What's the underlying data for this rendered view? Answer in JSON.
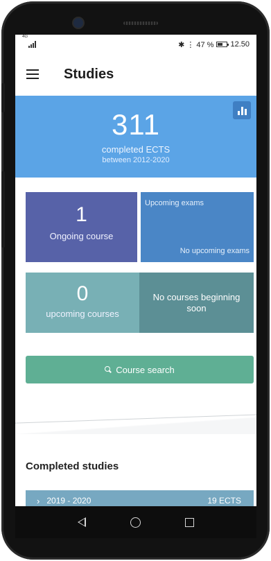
{
  "statusbar": {
    "network": "4G",
    "right_text": "✱ ⋮ 47 %",
    "time": "12.50"
  },
  "appbar": {
    "title": "Studies",
    "menu_icon": "hamburger-menu-icon"
  },
  "hero": {
    "value": "311",
    "label": "completed ECTS",
    "period": "between 2012-2020",
    "stats_icon": "bar-chart-icon"
  },
  "tiles": {
    "ongoing": {
      "value": "1",
      "label": "Ongoing course"
    },
    "upcoming_exams": {
      "title": "Upcoming exams",
      "empty_text": "No upcoming exams"
    },
    "upcoming_courses": {
      "value": "0",
      "label": "upcoming courses"
    },
    "no_courses": {
      "text": "No courses beginning soon"
    }
  },
  "search": {
    "label": "Course search",
    "icon": "search-icon"
  },
  "completed": {
    "title": "Completed studies",
    "rows": [
      {
        "period": "2019 - 2020",
        "ects": "19 ECTS"
      }
    ]
  },
  "colors": {
    "hero": "#5ba4e6",
    "ongoing": "#5762a8",
    "upcoming_exams": "#4a86c6",
    "upcoming_courses": "#78b0b5",
    "no_courses": "#5c8f95",
    "search_button": "#5faf94",
    "study_row": "#77a8c1"
  },
  "navbar": {
    "back_icon": "back-triangle-icon",
    "home_icon": "home-circle-icon",
    "recent_icon": "recent-apps-icon"
  }
}
